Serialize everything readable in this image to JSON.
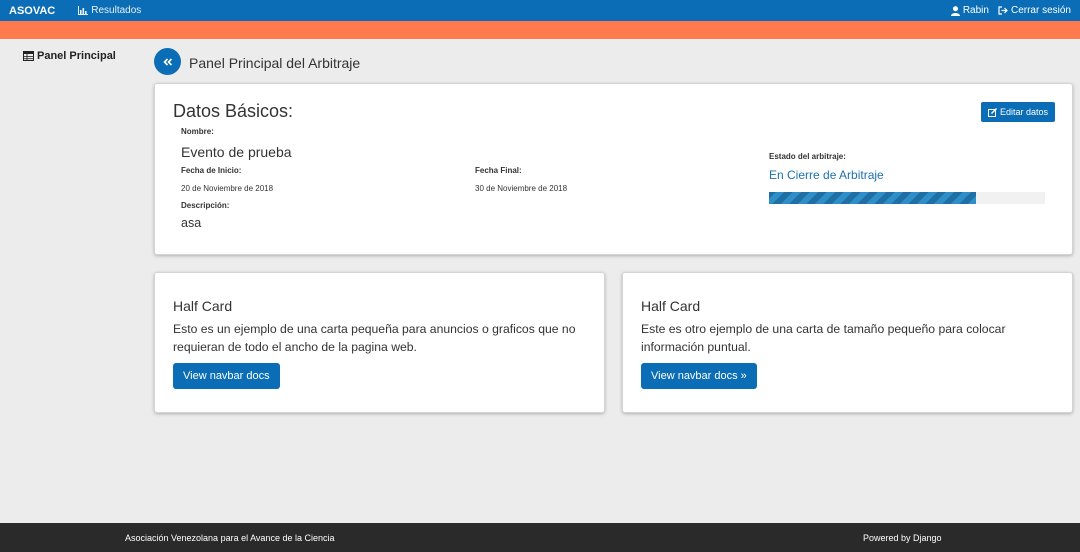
{
  "navbar": {
    "brand": "ASOVAC",
    "results_link": "Resultados",
    "user_name": "Rabin",
    "logout_label": "Cerrar sesión",
    "colors": {
      "primary": "#0a6db5",
      "accent_bar": "#ff7a4d"
    }
  },
  "sidebar": {
    "items": [
      {
        "label": "Panel Principal",
        "icon": "table-icon"
      }
    ]
  },
  "header": {
    "title": "Panel Principal del Arbitraje",
    "back_icon": "double-chevron-left-icon"
  },
  "basic_data": {
    "heading": "Datos Básicos:",
    "edit_label": "Editar datos",
    "name_label": "Nombre:",
    "name_value": "Evento de prueba",
    "start_label": "Fecha de Inicio:",
    "start_value": "20 de Noviembre de 2018",
    "end_label": "Fecha Final:",
    "end_value": "30 de Noviembre de 2018",
    "description_label": "Descripción:",
    "description_value": "asa",
    "status_label": "Estado del arbitraje:",
    "status_value": "En Cierre de Arbitraje",
    "progress": 0.75
  },
  "cards": [
    {
      "title": "Half Card",
      "text": "Esto es un ejemplo de una carta pequeña para anuncios o graficos que no requieran de todo el ancho de la pagina web.",
      "button": "View navbar docs"
    },
    {
      "title": "Half Card",
      "text": "Este es otro ejemplo de una carta de tamaño pequeño para colocar información puntual.",
      "button": "View navbar docs »"
    }
  ],
  "footer": {
    "left": "Asociación Venezolana para el Avance de la Ciencia",
    "right": "Powered by Django"
  }
}
